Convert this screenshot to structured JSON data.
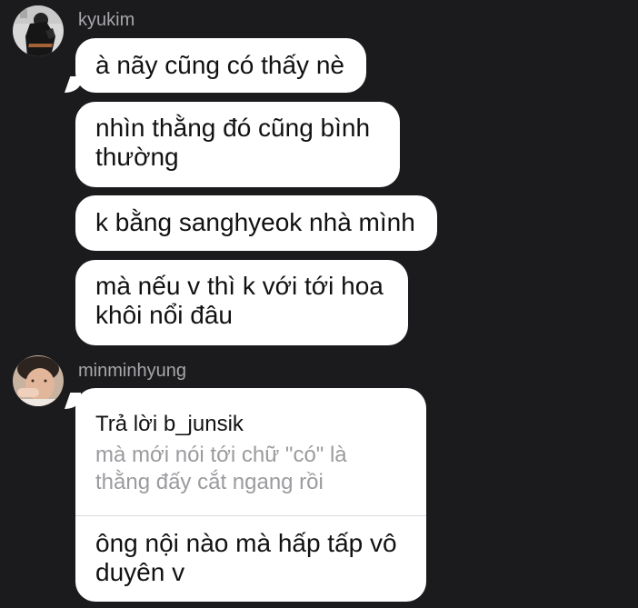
{
  "conversation": {
    "group1": {
      "username": "kyukim",
      "messages": [
        "à nãy cũng có thấy nè",
        "nhìn thằng đó cũng bình thường",
        "k bằng sanghyeok nhà mình",
        "mà nếu v thì k với tới hoa khôi nổi đâu"
      ]
    },
    "group2": {
      "username": "minminhyung",
      "reply": {
        "header": "Trả lời b_junsik",
        "quoted": "mà mới nói tới chữ \"có\" là thằng đấy cắt ngang rồi",
        "text": "ông nội nào mà hấp tấp vô duyên v"
      }
    }
  }
}
